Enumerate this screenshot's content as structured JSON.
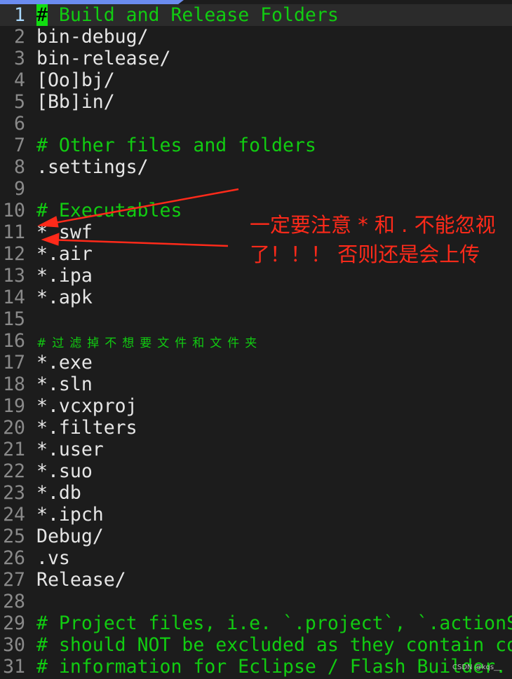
{
  "editor": {
    "lines": [
      {
        "n": "1",
        "text": "# Build and Release Folders",
        "type": "comment"
      },
      {
        "n": "2",
        "text": "bin-debug/",
        "type": "code"
      },
      {
        "n": "3",
        "text": "bin-release/",
        "type": "code"
      },
      {
        "n": "4",
        "text": "[Oo]bj/",
        "type": "code"
      },
      {
        "n": "5",
        "text": "[Bb]in/",
        "type": "code"
      },
      {
        "n": "6",
        "text": "",
        "type": "code"
      },
      {
        "n": "7",
        "text": "# Other files and folders",
        "type": "comment"
      },
      {
        "n": "8",
        "text": ".settings/",
        "type": "code"
      },
      {
        "n": "9",
        "text": "",
        "type": "code"
      },
      {
        "n": "10",
        "text": "# Executables",
        "type": "comment"
      },
      {
        "n": "11",
        "text": "*.swf",
        "type": "code"
      },
      {
        "n": "12",
        "text": "*.air",
        "type": "code"
      },
      {
        "n": "13",
        "text": "*.ipa",
        "type": "code"
      },
      {
        "n": "14",
        "text": "*.apk",
        "type": "code"
      },
      {
        "n": "15",
        "text": "",
        "type": "code"
      },
      {
        "n": "16",
        "text": "#过滤掉不想要文件和文件夹",
        "type": "cjk"
      },
      {
        "n": "17",
        "text": "*.exe",
        "type": "code"
      },
      {
        "n": "18",
        "text": "*.sln",
        "type": "code"
      },
      {
        "n": "19",
        "text": "*.vcxproj",
        "type": "code"
      },
      {
        "n": "20",
        "text": "*.filters",
        "type": "code"
      },
      {
        "n": "21",
        "text": "*.user",
        "type": "code"
      },
      {
        "n": "22",
        "text": "*.suo",
        "type": "code"
      },
      {
        "n": "23",
        "text": "*.db",
        "type": "code"
      },
      {
        "n": "24",
        "text": "*.ipch",
        "type": "code"
      },
      {
        "n": "25",
        "text": "Debug/",
        "type": "code"
      },
      {
        "n": "26",
        "text": ".vs",
        "type": "code"
      },
      {
        "n": "27",
        "text": "Release/",
        "type": "code"
      },
      {
        "n": "28",
        "text": "",
        "type": "code"
      },
      {
        "n": "29",
        "text": "# Project files, i.e. `.project`, `.actionS",
        "type": "comment"
      },
      {
        "n": "30",
        "text": "# should NOT be excluded as they contain co",
        "type": "comment"
      },
      {
        "n": "31",
        "text": "# information for Eclipse / Flash Builder.",
        "type": "comment"
      }
    ]
  },
  "annotation": {
    "text": "一定要注意 * 和 . 不能忽视了！！！ 否则还是会上传",
    "color": "#ff2a1a"
  },
  "watermark": "CSDN @kqs__",
  "colors": {
    "background": "#1c1c1c",
    "comment": "#11cc11",
    "text": "#e6e6e6",
    "tab": "#6b8cf0"
  }
}
